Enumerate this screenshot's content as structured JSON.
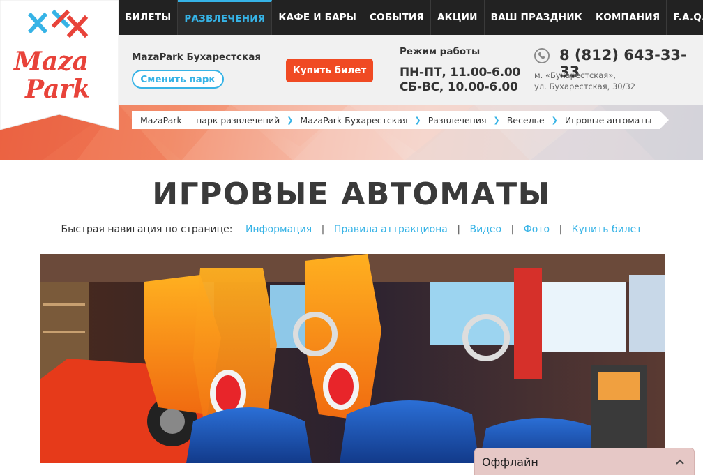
{
  "nav": {
    "items": [
      {
        "label": "БИЛЕТЫ",
        "active": false
      },
      {
        "label": "РАЗВЛЕЧЕНИЯ",
        "active": true
      },
      {
        "label": "КАФЕ И БАРЫ",
        "active": false
      },
      {
        "label": "СОБЫТИЯ",
        "active": false
      },
      {
        "label": "АКЦИИ",
        "active": false
      },
      {
        "label": "ВАШ ПРАЗДНИК",
        "active": false
      },
      {
        "label": "КОМПАНИЯ",
        "active": false
      },
      {
        "label": "F.A.Q.",
        "active": false
      }
    ],
    "active_color": "#36b3e6"
  },
  "logo": {
    "text_line1": "Maza",
    "text_line2": "Park",
    "brand_red": "#e8433a",
    "brand_blue": "#36b3e6"
  },
  "header": {
    "park_name": "MazaPark Бухарестская",
    "change_park_label": "Сменить парк",
    "buy_ticket_label": "Купить билет",
    "hours_title": "Режим работы",
    "hours_weekdays": "ПН-ПТ, 11.00-6.00",
    "hours_weekend": "СБ-ВС, 10.00-6.00",
    "phone": "8 (812) 643-33-33",
    "address_metro": "м. «Бухарестская»,",
    "address_street": "ул. Бухарестская, 30/32",
    "accent_color": "#f04a23"
  },
  "breadcrumb": [
    "MazaPark — парк развлечений",
    "MazaPark Бухарестская",
    "Развлечения",
    "Веселье",
    "Игровые автоматы"
  ],
  "page": {
    "title": "ИГРОВЫЕ АВТОМАТЫ",
    "quicknav_lead": "Быстрая навигация по странице:",
    "quicknav_links": [
      "Информация",
      "Правила аттракциона",
      "Видео",
      "Фото",
      "Купить билет"
    ]
  },
  "chat": {
    "status": "Оффлайн"
  }
}
